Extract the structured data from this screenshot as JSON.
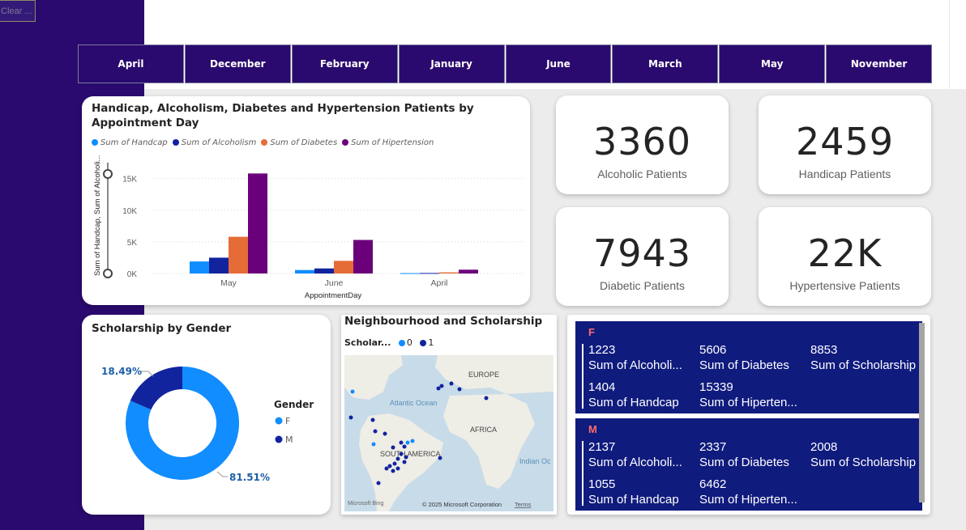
{
  "clear_button": {
    "label": "Clear ..."
  },
  "months": [
    "April",
    "December",
    "February",
    "January",
    "June",
    "March",
    "May",
    "November"
  ],
  "bar_chart": {
    "title": "Handicap, Alcoholism, Diabetes and Hypertension Patients by Appointment Day",
    "legend": [
      {
        "name": "Sum of Handcap",
        "color": "#118dff"
      },
      {
        "name": "Sum of Alcoholism",
        "color": "#12239e"
      },
      {
        "name": "Sum of Diabetes",
        "color": "#e66c37"
      },
      {
        "name": "Sum of Hipertension",
        "color": "#6b007b"
      }
    ],
    "ylabel": "Sum of Handcap, Sum of Alcoholi...",
    "xlabel": "AppointmentDay",
    "yticks": [
      "0K",
      "5K",
      "10K",
      "15K"
    ]
  },
  "chart_data": {
    "type": "bar",
    "categories": [
      "May",
      "June",
      "April"
    ],
    "series": [
      {
        "name": "Sum of Handcap",
        "values": [
          1900,
          550,
          60
        ]
      },
      {
        "name": "Sum of Alcoholism",
        "values": [
          2500,
          800,
          80
        ]
      },
      {
        "name": "Sum of Diabetes",
        "values": [
          5800,
          2000,
          180
        ]
      },
      {
        "name": "Sum of Hipertension",
        "values": [
          15800,
          5300,
          600
        ]
      }
    ],
    "title": "Handicap, Alcoholism, Diabetes and Hypertension Patients by Appointment Day",
    "xlabel": "AppointmentDay",
    "ylabel": "Sum of Handcap, Sum of Alcoholi...",
    "ylim": [
      0,
      17000
    ],
    "grid": true,
    "legend_position": "top-left"
  },
  "kpis": [
    {
      "value": "3360",
      "label": "Alcoholic Patients"
    },
    {
      "value": "2459",
      "label": "Handicap Patients"
    },
    {
      "value": "7943",
      "label": "Diabetic Patients"
    },
    {
      "value": "22K",
      "label": "Hypertensive Patients"
    }
  ],
  "donut": {
    "title": "Scholarship by Gender",
    "legend_title": "Gender",
    "legend": [
      {
        "name": "F",
        "color": "#118dff"
      },
      {
        "name": "M",
        "color": "#12239e"
      }
    ],
    "labels": {
      "small": "18.49%",
      "large": "81.51%"
    },
    "shares": {
      "F": 0.8151,
      "M": 0.1849
    }
  },
  "map": {
    "title": "Neighbourhood and Scholarship",
    "legend_label": "Scholar...",
    "legend_items": [
      {
        "name": "0",
        "color": "#118dff"
      },
      {
        "name": "1",
        "color": "#12239e"
      }
    ],
    "labels": {
      "europe": "EUROPE",
      "atlantic": "Atlantic Ocean",
      "africa": "AFRICA",
      "south_america": "SOUTH AMERICA",
      "indian": "Indian Oc"
    },
    "attribution": "© 2025 Microsoft Corporation",
    "terms": "Terms",
    "bing": "Microsoft Bing"
  },
  "multirow": [
    {
      "gender": "F",
      "items": [
        {
          "value": "1223",
          "label": "Sum of Alcoholi..."
        },
        {
          "value": "5606",
          "label": "Sum of Diabetes"
        },
        {
          "value": "8853",
          "label": "Sum of Scholarship"
        },
        {
          "value": "1404",
          "label": "Sum of Handcap"
        },
        {
          "value": "15339",
          "label": "Sum of Hiperten..."
        }
      ]
    },
    {
      "gender": "M",
      "items": [
        {
          "value": "2137",
          "label": "Sum of Alcoholi..."
        },
        {
          "value": "2337",
          "label": "Sum of Diabetes"
        },
        {
          "value": "2008",
          "label": "Sum of Scholarship"
        },
        {
          "value": "1055",
          "label": "Sum of Handcap"
        },
        {
          "value": "6462",
          "label": "Sum of Hiperten..."
        }
      ]
    }
  ]
}
